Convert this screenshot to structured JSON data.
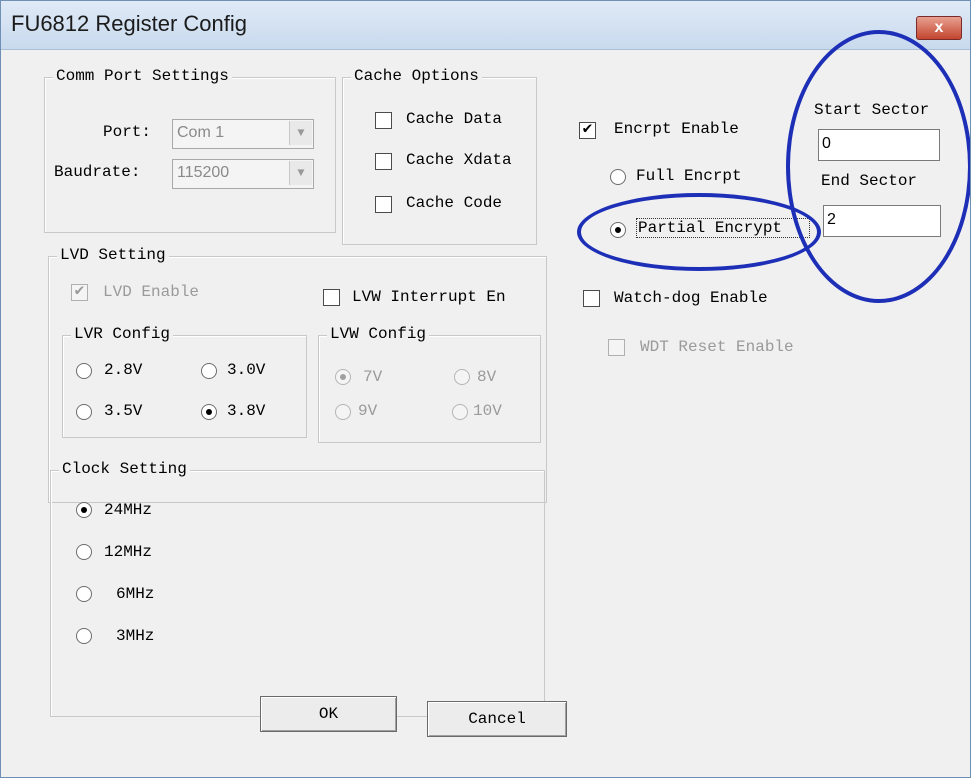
{
  "window": {
    "title": "FU6812 Register Config",
    "close_label": "x"
  },
  "comm_port": {
    "legend": "Comm Port Settings",
    "port_label": "Port:",
    "port_value": "Com 1",
    "baudrate_label": "Baudrate:",
    "baudrate_value": "115200"
  },
  "cache_options": {
    "legend": "Cache Options",
    "items": [
      {
        "label": "Cache Data",
        "checked": false
      },
      {
        "label": "Cache Xdata",
        "checked": false
      },
      {
        "label": "Cache Code",
        "checked": false
      }
    ]
  },
  "lvd": {
    "legend": "LVD Setting",
    "lvd_enable": "LVD Enable",
    "lvw_interrupt": "LVW Interrupt En",
    "lvr_legend": "LVR Config",
    "lvr_options": [
      "2.8V",
      "3.0V",
      "3.5V",
      "3.8V"
    ],
    "lvr_selected": "3.8V",
    "lvw_legend": "LVW Config",
    "lvw_options": [
      "7V",
      "8V",
      "9V",
      "10V"
    ],
    "lvw_selected": "7V"
  },
  "clock": {
    "legend": "Clock Setting",
    "options": [
      "24MHz",
      "12MHz",
      "6MHz",
      "3MHz"
    ],
    "selected": "24MHz"
  },
  "encrypt": {
    "enable_label": "Encrpt Enable",
    "enable_checked": true,
    "full_label": "Full Encrpt",
    "partial_label": "Partial Encrypt",
    "selected": "Partial Encrypt",
    "start_sector_label": "Start Sector",
    "start_sector_value": "0",
    "end_sector_label": "End Sector",
    "end_sector_value": "2"
  },
  "watchdog": {
    "enable_label": "Watch-dog Enable",
    "wdt_reset_label": "WDT Reset Enable"
  },
  "buttons": {
    "ok": "OK",
    "cancel": "Cancel"
  },
  "colors": {
    "annotation": "#1d2fb7",
    "title_bar": "#c9daee",
    "close_button": "#c2452f"
  },
  "icons": {
    "check": "✔",
    "radio_dot": "•"
  }
}
